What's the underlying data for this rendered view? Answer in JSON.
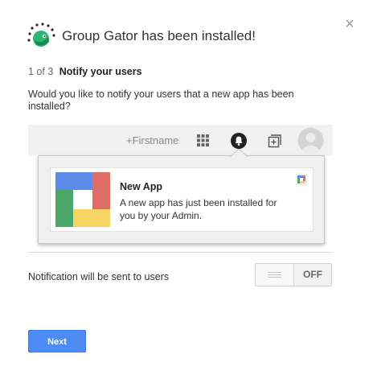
{
  "dialog": {
    "title": "Group Gator has been installed!",
    "close_symbol": "×",
    "icons": {
      "logo": "group-gator-logo-icon",
      "close": "close-icon"
    }
  },
  "step": {
    "count": "1 of 3",
    "title": "Notify your users"
  },
  "question": "Would you like to notify your users that a new app has been installed?",
  "preview": {
    "bar": {
      "name": "+Firstname",
      "icons": [
        "apps-grid-icon",
        "notifications-bell-icon",
        "add-share-icon",
        "avatar-icon"
      ]
    },
    "notification": {
      "title": "New App",
      "body": "A new app has just been installed for you by your Admin.",
      "icons": [
        "app-icon",
        "app-mini-logo-icon"
      ]
    }
  },
  "notification_setting": {
    "label": "Notification will be sent to users",
    "toggle_state": "OFF"
  },
  "actions": {
    "next_label": "Next"
  },
  "colors": {
    "primary_button": "#4d8cf5",
    "logo_green": "#2bb673",
    "app_icon_blue": "#5b8de8",
    "app_icon_red": "#e06c66",
    "app_icon_green": "#4aa86b",
    "app_icon_yellow": "#f6d565"
  }
}
